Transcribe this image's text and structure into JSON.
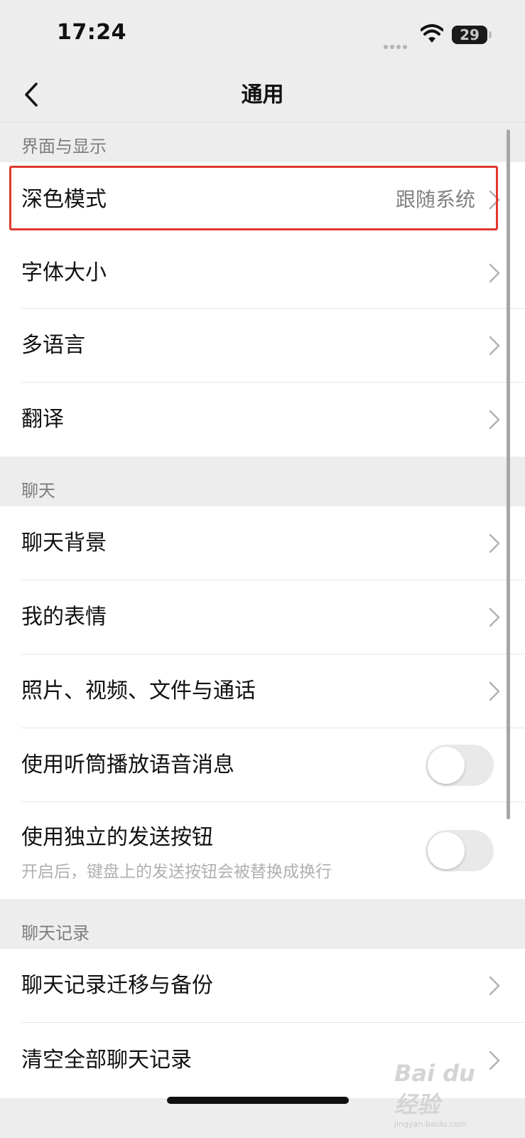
{
  "status_bar": {
    "time": "17:24",
    "battery": "29",
    "icons": [
      "signal-dots-icon",
      "wifi-icon",
      "battery-icon"
    ]
  },
  "nav": {
    "title": "通用",
    "back_icon": "chevron-left-icon"
  },
  "sections": [
    {
      "header": "界面与显示",
      "rows": [
        {
          "label": "深色模式",
          "value": "跟随系统",
          "highlighted": true
        },
        {
          "label": "字体大小"
        },
        {
          "label": "多语言"
        },
        {
          "label": "翻译"
        }
      ]
    },
    {
      "header": "聊天",
      "rows": [
        {
          "label": "聊天背景"
        },
        {
          "label": "我的表情"
        },
        {
          "label": "照片、视频、文件与通话"
        },
        {
          "label": "使用听筒播放语音消息",
          "toggle": false
        },
        {
          "label": "使用独立的发送按钮",
          "subtitle": "开启后，键盘上的发送按钮会被替换成换行",
          "toggle": false
        }
      ]
    },
    {
      "header": "聊天记录",
      "rows": [
        {
          "label": "聊天记录迁移与备份"
        },
        {
          "label": "清空全部聊天记录"
        }
      ]
    }
  ],
  "watermark": {
    "text": "Bai du 经验",
    "sub": "jingyan.baidu.com"
  },
  "colors": {
    "background": "#ededed",
    "highlight_border": "#e0382e",
    "toggle_off": "#e9e9e9"
  }
}
